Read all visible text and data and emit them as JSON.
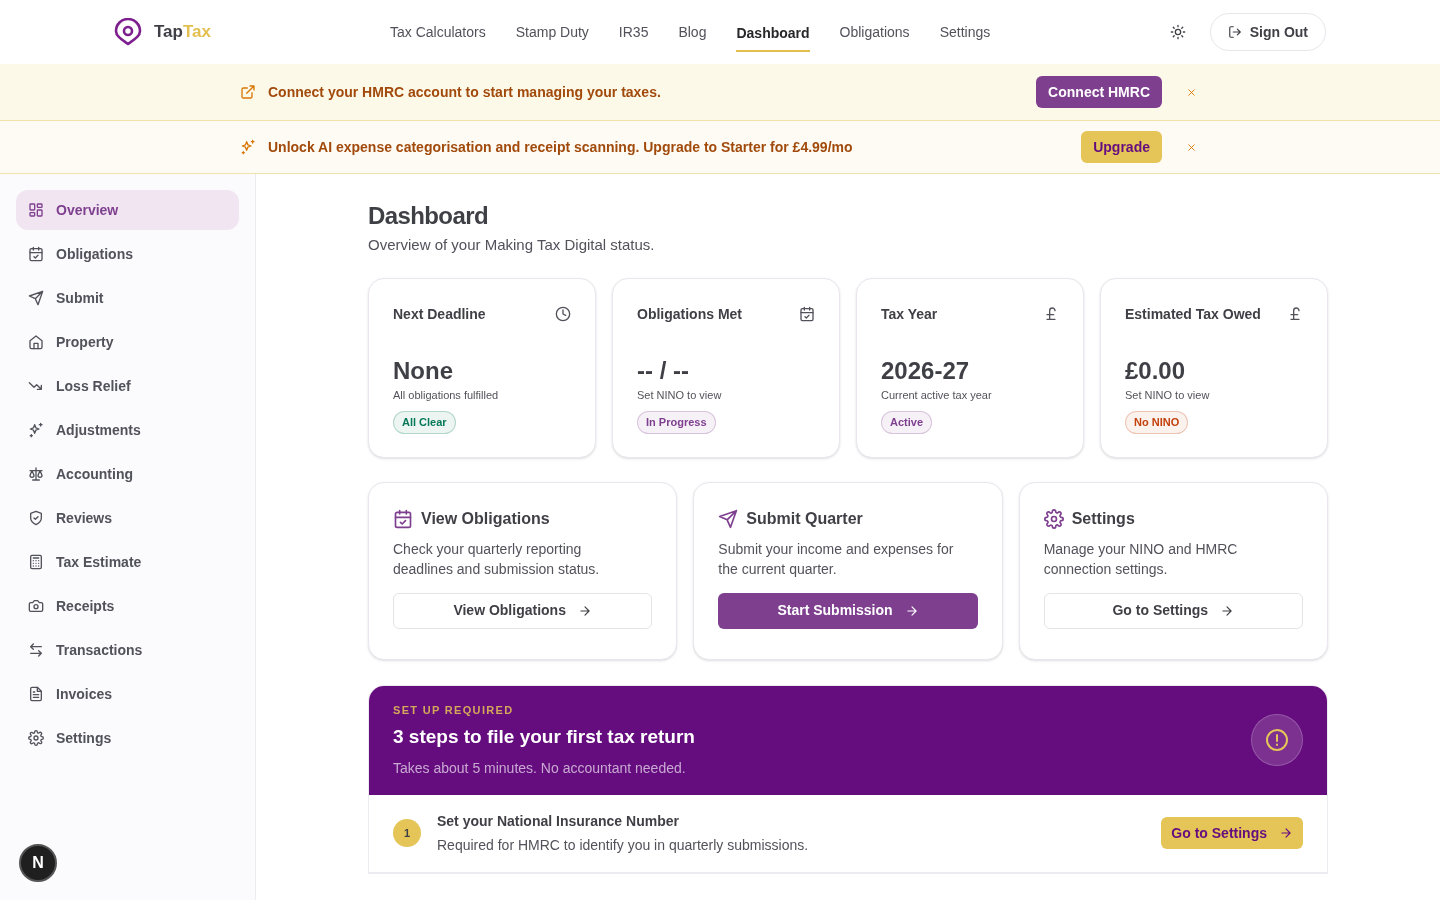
{
  "header": {
    "logo": {
      "first": "Tap",
      "second": "Tax"
    },
    "nav": [
      {
        "label": "Tax Calculators",
        "selected": false
      },
      {
        "label": "Stamp Duty",
        "selected": false
      },
      {
        "label": "IR35",
        "selected": false
      },
      {
        "label": "Blog",
        "selected": false
      },
      {
        "label": "Dashboard",
        "selected": true
      },
      {
        "label": "Obligations",
        "selected": false
      },
      {
        "label": "Settings",
        "selected": false
      }
    ],
    "sign_out": "Sign Out"
  },
  "banners": [
    {
      "kind": "connect",
      "text": "Connect your HMRC account to start managing your taxes.",
      "button": "Connect HMRC"
    },
    {
      "kind": "upgrade",
      "text": "Unlock AI expense categorisation and receipt scanning. Upgrade to Starter for **£4.99/mo**",
      "button": "Upgrade"
    }
  ],
  "sidebar": {
    "items": [
      {
        "label": "Overview",
        "selected": true
      },
      {
        "label": "Obligations",
        "selected": false
      },
      {
        "label": "Submit",
        "selected": false
      },
      {
        "label": "Property",
        "selected": false
      },
      {
        "label": "Loss Relief",
        "selected": false
      },
      {
        "label": "Adjustments",
        "selected": false
      },
      {
        "label": "Accounting",
        "selected": false
      },
      {
        "label": "Reviews",
        "selected": false
      },
      {
        "label": "Tax Estimate",
        "selected": false
      },
      {
        "label": "Receipts",
        "selected": false
      },
      {
        "label": "Transactions",
        "selected": false
      },
      {
        "label": "Invoices",
        "selected": false
      },
      {
        "label": "Settings",
        "selected": false
      }
    ],
    "avatar": "N"
  },
  "page": {
    "title": "Dashboard",
    "subtitle": "Overview of your Making Tax Digital status."
  },
  "stats": [
    {
      "title": "Next Deadline",
      "value": "None",
      "note": "All obligations fulfilled",
      "badge": "All Clear",
      "color": "#047857"
    },
    {
      "title": "Obligations Met",
      "value": "-- / --",
      "note": "Set NINO to view",
      "badge": "In Progress",
      "color": "#7e3f8f"
    },
    {
      "title": "Tax Year",
      "value": "2026-27",
      "note": "Current active tax year",
      "badge": "Active",
      "color": "#7e3f8f"
    },
    {
      "title": "Estimated Tax Owed",
      "value": "£0.00",
      "note": "Set NINO to view",
      "badge": "No NINO",
      "color": "#c2410c"
    }
  ],
  "actions": [
    {
      "title": "View Obligations",
      "text": "Check your quarterly reporting deadlines and submission status.",
      "button": "View Obligations",
      "kind": "outline"
    },
    {
      "title": "Submit Quarter",
      "text": "Submit your income and expenses for the current quarter.",
      "button": "Start Submission",
      "kind": "primary"
    },
    {
      "title": "Settings",
      "text": "Manage your NINO and HMRC connection settings.",
      "button": "Go to Settings",
      "kind": "outline"
    }
  ],
  "setup": {
    "eyebrow": "SET UP REQUIRED",
    "title": "3 steps to file your first tax return",
    "subtitle": "Takes about 5 minutes. No accountant needed.",
    "steps": [
      {
        "number": "1",
        "title": "Set your National Insurance Number",
        "text": "Required for HMRC to identify you in quarterly submissions.",
        "button": "Go to Settings",
        "active": true
      }
    ]
  }
}
